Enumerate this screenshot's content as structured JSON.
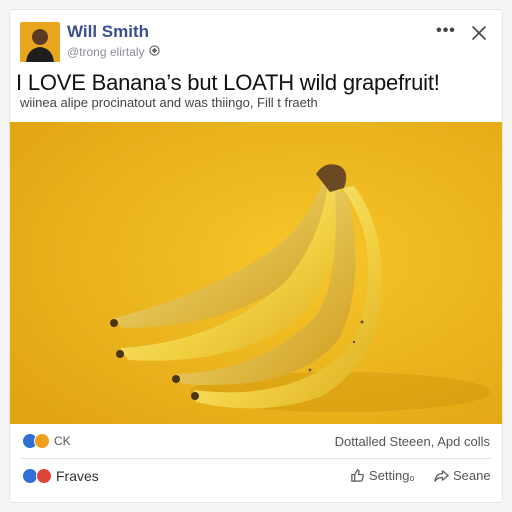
{
  "post": {
    "author_name": "Will Smith",
    "author_handle": "@trong elirtaly",
    "headline": "I LOVE Banana’s but LOATH wild grapefruit!",
    "subline": "wiinea alipe procinatout and was thiingo, Fill t fraeth"
  },
  "stats": {
    "reactions_label": "CK",
    "comments_share": "Dottalled Steeen, Apd colls"
  },
  "actions": {
    "left_label": "Fraves",
    "setting_label": "Settingₒ",
    "share_label": "Seane"
  },
  "colors": {
    "author_link": "#3b4f8c",
    "photo_background": "#efb418",
    "banana": "#f3d34a",
    "reaction_blue": "#2f6fd6",
    "reaction_orange": "#f0a020",
    "reaction_red": "#e0453a"
  }
}
